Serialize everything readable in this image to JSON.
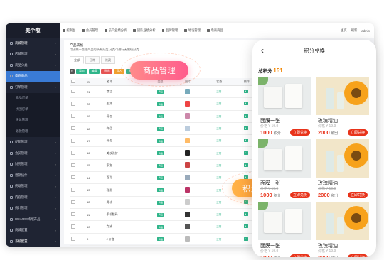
{
  "sidebar": {
    "logo": "美个啦",
    "items": [
      {
        "label": "商城管理",
        "type": "head"
      },
      {
        "label": "店铺管理",
        "type": "normal"
      },
      {
        "label": "商品分类",
        "type": "normal"
      },
      {
        "label": "电商商品",
        "type": "active"
      },
      {
        "label": "订单管理",
        "type": "normal"
      },
      {
        "label": "商品订单",
        "type": "sub"
      },
      {
        "label": "拼团订单",
        "type": "sub"
      },
      {
        "label": "评论管理",
        "type": "sub"
      },
      {
        "label": "退款管理",
        "type": "sub"
      },
      {
        "label": "促销管理",
        "type": "normal"
      },
      {
        "label": "会员管理",
        "type": "normal"
      },
      {
        "label": "财务管理",
        "type": "normal"
      },
      {
        "label": "营销插件",
        "type": "normal"
      },
      {
        "label": "终端管理",
        "type": "normal"
      },
      {
        "label": "内容管理",
        "type": "normal"
      },
      {
        "label": "统计管理",
        "type": "normal"
      },
      {
        "label": "UNI-APP终端产品",
        "type": "normal"
      },
      {
        "label": "商城配置",
        "type": "normal"
      },
      {
        "label": "系统配置",
        "type": "head"
      }
    ]
  },
  "topbar": {
    "nav": [
      "控制台",
      "会员管理",
      "员工业绩分析",
      "团队业绩分析",
      "品牌管理",
      "地址管理",
      "电商商品"
    ],
    "right": [
      "主页",
      "刷新",
      "admin"
    ]
  },
  "content": {
    "title": "产品表格",
    "desc": "用于统一管理产品的所有分类,分类可进行无限级分类",
    "tabs": [
      "全部",
      "正常",
      "隐藏"
    ],
    "toolbar": [
      {
        "label": "",
        "color": "#555555"
      },
      {
        "label": "添加",
        "color": "#2fb58a"
      },
      {
        "label": "编辑",
        "color": "#2fb58a"
      },
      {
        "label": "删除",
        "color": "#e55353"
      },
      {
        "label": "导入",
        "color": "#f0a030"
      },
      {
        "label": "批量上下架",
        "color": "#2fb58a"
      },
      {
        "label": "数据生成",
        "color": "#3a7bd5"
      },
      {
        "label": "图片同步",
        "color": "#f08a24"
      }
    ],
    "columns": [
      "",
      "ID",
      "名称",
      "类型",
      "图片",
      "状态",
      "操作"
    ],
    "rows": [
      {
        "id": "21",
        "name": "食品",
        "tag": "商品",
        "status": "正常",
        "img": "#7ab"
      },
      {
        "id": "20",
        "name": "生鲜",
        "tag": "商品",
        "status": "正常",
        "img": "#e44"
      },
      {
        "id": "19",
        "name": "母包",
        "tag": "商品",
        "status": "正常",
        "img": "#c8a"
      },
      {
        "id": "18",
        "name": "饰品",
        "tag": "商品",
        "status": "正常",
        "img": "#bcd"
      },
      {
        "id": "17",
        "name": "母婴",
        "tag": "商品",
        "status": "正常",
        "img": "#fb6"
      },
      {
        "id": "16",
        "name": "美妆洗护",
        "tag": "商品",
        "status": "正常",
        "img": "#222"
      },
      {
        "id": "15",
        "name": "家电",
        "tag": "商品",
        "status": "正常",
        "img": "#c44"
      },
      {
        "id": "14",
        "name": "百货",
        "tag": "商品",
        "status": "正常",
        "img": "#9ab"
      },
      {
        "id": "13",
        "name": "鞋靴",
        "tag": "商品",
        "status": "正常",
        "img": "#b36"
      },
      {
        "id": "12",
        "name": "男装",
        "tag": "商品",
        "status": "正常",
        "img": "#ccc"
      },
      {
        "id": "11",
        "name": "手机数码",
        "tag": "商品",
        "status": "正常",
        "img": "#333"
      },
      {
        "id": "10",
        "name": "女装",
        "tag": "商品",
        "status": "正常",
        "img": "#555"
      },
      {
        "id": "9",
        "name": "J 卉者",
        "tag": "商品",
        "status": "正常",
        "img": "#bbb"
      }
    ]
  },
  "pills": {
    "left": "商品管理",
    "right": "积分兑换"
  },
  "phone": {
    "title": "积分兑换",
    "points_label": "总积分",
    "points_value": "151",
    "cards": [
      {
        "name": "面膜一张",
        "orig": "价格 ¥ 19.9",
        "pts": "1000",
        "unit": "积分",
        "btn": "立即兑换"
      },
      {
        "name": "玫瑰精油",
        "orig": "价格 ¥ 19.9",
        "pts": "2000",
        "unit": "积分",
        "btn": "立即兑换"
      },
      {
        "name": "面膜一张",
        "orig": "价格 ¥ 19.9",
        "pts": "1000",
        "unit": "积分",
        "btn": "立即兑换"
      },
      {
        "name": "玫瑰精油",
        "orig": "价格 ¥ 19.9",
        "pts": "2000",
        "unit": "积分",
        "btn": "立即兑换"
      },
      {
        "name": "面膜一张",
        "orig": "价格 ¥ 19.9",
        "pts": "1000",
        "unit": "积分",
        "btn": "立即兑换"
      },
      {
        "name": "玫瑰精油",
        "orig": "价格 ¥ 19.9",
        "pts": "2000",
        "unit": "积分",
        "btn": "立即兑换"
      }
    ]
  }
}
